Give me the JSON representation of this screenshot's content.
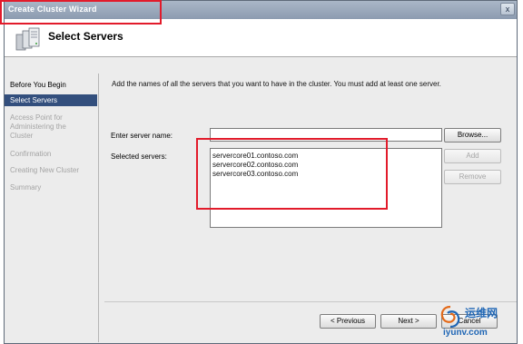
{
  "window": {
    "title": "Create Cluster Wizard",
    "close_glyph": "x"
  },
  "header": {
    "title": "Select Servers",
    "icon": "cluster-servers-icon"
  },
  "sidebar": {
    "items": [
      {
        "label": "Before You Begin",
        "state": "done"
      },
      {
        "label": "Select Servers",
        "state": "active"
      },
      {
        "label": "Access Point for Administering the Cluster",
        "state": "pending"
      },
      {
        "label": "Confirmation",
        "state": "pending"
      },
      {
        "label": "Creating New Cluster",
        "state": "pending"
      },
      {
        "label": "Summary",
        "state": "pending"
      }
    ]
  },
  "main": {
    "instructions": "Add the names of all the servers that you want to have in the cluster. You must add at least one server.",
    "server_name_label": "Enter server name:",
    "server_name_value": "",
    "selected_servers_label": "Selected servers:",
    "selected_servers": [
      "servercore01.contoso.com",
      "servercore02.contoso.com",
      "servercore03.contoso.com"
    ],
    "browse_label": "Browse...",
    "add_label": "Add",
    "remove_label": "Remove"
  },
  "footer": {
    "previous_label": "< Previous",
    "next_label": "Next >",
    "cancel_label": "Cancel"
  },
  "watermark": {
    "cn_text": "运维网",
    "url": "iyunv.com"
  },
  "colors": {
    "annotation": "#e21b2b",
    "active_nav": "#334f7d",
    "titlebar": "#97a5b9"
  }
}
